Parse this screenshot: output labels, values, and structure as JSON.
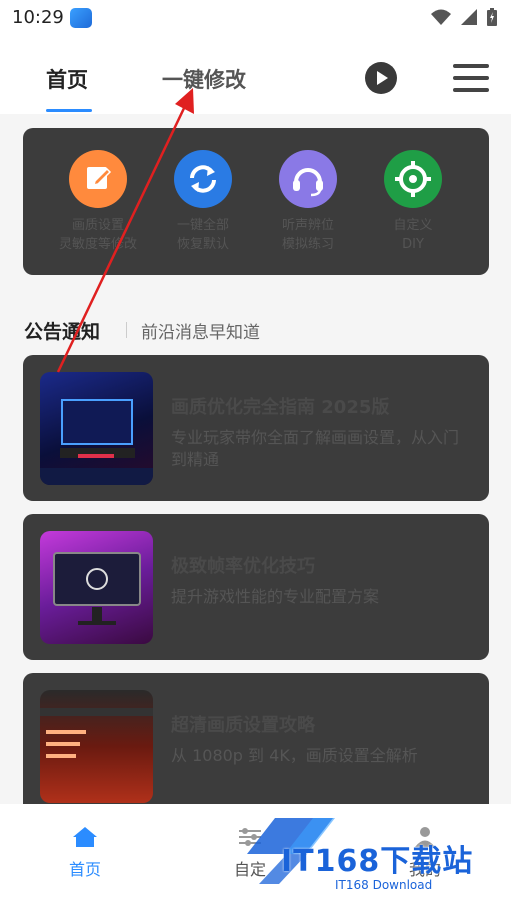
{
  "status_bar": {
    "time": "10:29"
  },
  "header": {
    "tabs": [
      {
        "label": "首页"
      },
      {
        "label": "一键修改"
      }
    ]
  },
  "quick_actions": [
    {
      "line1": "画质设置",
      "line2": "灵敏度等修改",
      "icon": "edit-icon",
      "color": "#ff8a3d"
    },
    {
      "line1": "一键全部",
      "line2": "恢复默认",
      "icon": "refresh-icon",
      "color": "#2a7be4"
    },
    {
      "line1": "听声辨位",
      "line2": "模拟练习",
      "icon": "headset-icon",
      "color": "#8a79e6"
    },
    {
      "line1": "自定义",
      "line2": "DIY",
      "icon": "crosshair-icon",
      "color": "#1f9e46"
    }
  ],
  "section": {
    "title": "公告通知",
    "subtitle": "前沿消息早知道"
  },
  "news": [
    {
      "title": "画质优化完全指南 2025版",
      "desc": "专业玩家带你全面了解画画设置，从入门到精通"
    },
    {
      "title": "极致帧率优化技巧",
      "desc": "提升游戏性能的专业配置方案"
    },
    {
      "title": "超清画质设置攻略",
      "desc": "从 1080p 到 4K，画质设置全解析"
    }
  ],
  "bottom_nav": [
    {
      "label": "首页",
      "icon": "home-icon",
      "active": true
    },
    {
      "label": "自定",
      "icon": "sliders-icon",
      "active": false
    },
    {
      "label": "我的",
      "icon": "person-icon",
      "active": false
    }
  ],
  "watermark": {
    "brand": "IT168下载站",
    "sub": "IT168 Download"
  },
  "colors": {
    "accent": "#2b8cff",
    "overlay": "#3c3c3c",
    "arrow": "#e02020"
  }
}
